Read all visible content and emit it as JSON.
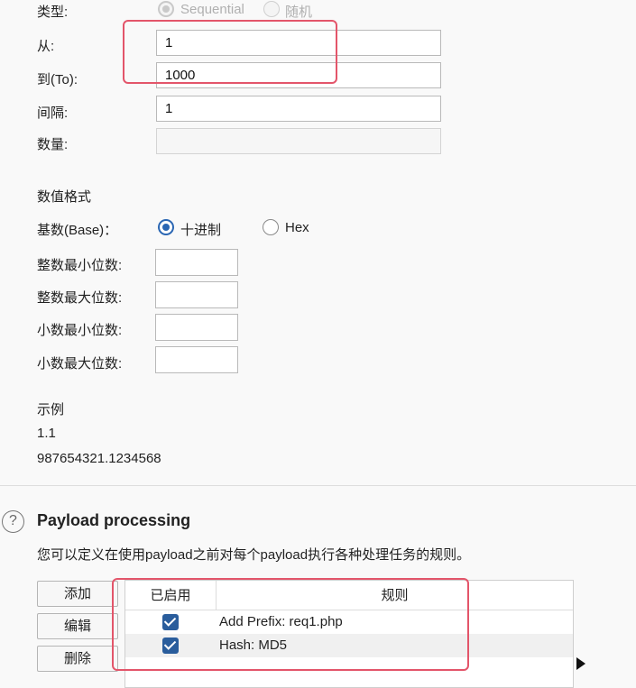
{
  "type_row": {
    "label": "类型:",
    "option_sequential": "Sequential",
    "option_random": "随机"
  },
  "range": {
    "from_label": "从:",
    "from_value": "1",
    "to_label": "到(To):",
    "to_value": "1000",
    "step_label": "间隔:",
    "step_value": "1",
    "count_label": "数量:",
    "count_value": ""
  },
  "number_format": {
    "heading": "数值格式",
    "base_label": "基数(Base)：",
    "base_decimal": "十进制",
    "base_hex": "Hex",
    "min_int_label": "整数最小位数:",
    "max_int_label": "整数最大位数:",
    "min_frac_label": "小数最小位数:",
    "max_frac_label": "小数最大位数:",
    "min_int_value": "",
    "max_int_value": "",
    "min_frac_value": "",
    "max_frac_value": ""
  },
  "example": {
    "heading": "示例",
    "line1": "1.1",
    "line2": "987654321.1234568"
  },
  "payload_processing": {
    "help_icon": "?",
    "title": "Payload processing",
    "description": "您可以定义在使用payload之前对每个payload执行各种处理任务的规则。",
    "buttons": {
      "add": "添加",
      "edit": "编辑",
      "remove": "删除"
    },
    "columns": {
      "enabled": "已启用",
      "rule": "规则"
    },
    "rows": [
      {
        "enabled": true,
        "rule": "Add Prefix: req1.php"
      },
      {
        "enabled": true,
        "rule": "Hash: MD5"
      }
    ]
  },
  "colors": {
    "highlight": "#e3556a",
    "accent": "#2a66b3"
  },
  "icons": {
    "expand_arrow": "cursor-arrow-icon"
  }
}
